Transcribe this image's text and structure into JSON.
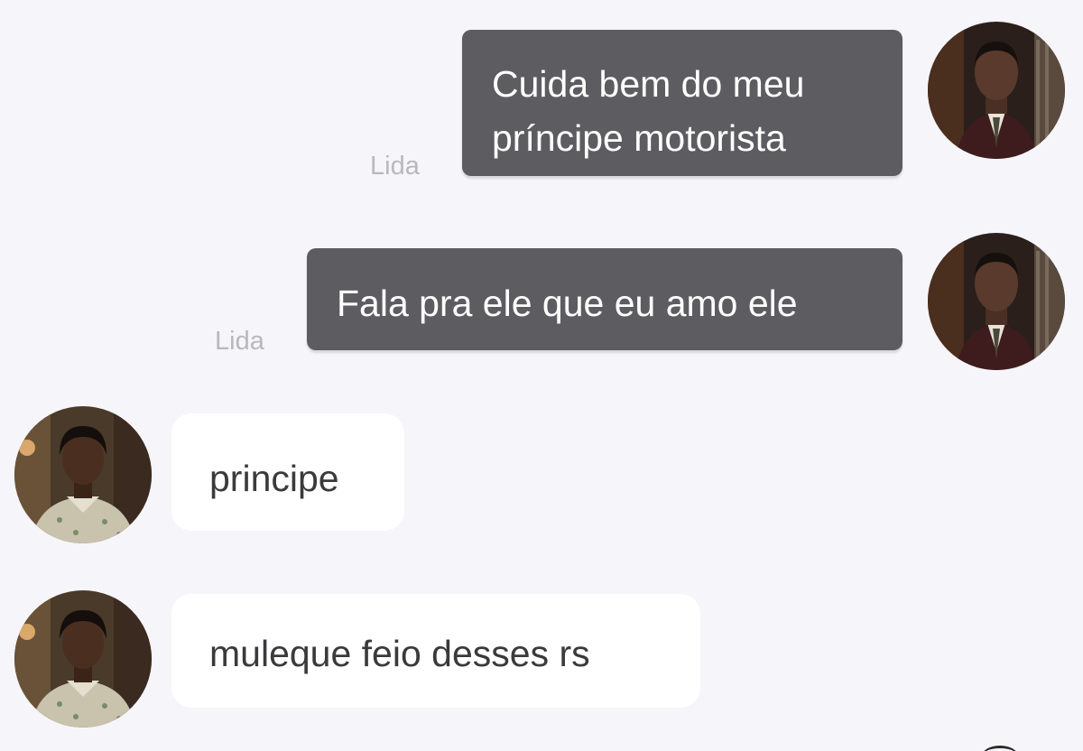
{
  "messages": [
    {
      "direction": "outgoing",
      "lines": [
        "Cuida bem do meu",
        "príncipe motorista"
      ],
      "status": "Lida",
      "avatar": "male-portrait-avatar"
    },
    {
      "direction": "outgoing",
      "lines": [
        "Fala pra ele que eu amo ele"
      ],
      "status": "Lida",
      "avatar": "male-portrait-avatar"
    },
    {
      "direction": "incoming",
      "lines": [
        "principe"
      ],
      "avatar": "female-portrait-avatar"
    },
    {
      "direction": "incoming",
      "lines": [
        "muleque feio desses rs"
      ],
      "avatar": "female-portrait-avatar"
    }
  ],
  "colors": {
    "background": "#f6f5f9",
    "outgoing_bubble": "#5d5d61",
    "incoming_bubble": "#ffffff",
    "status_text": "#b9b9bd"
  }
}
